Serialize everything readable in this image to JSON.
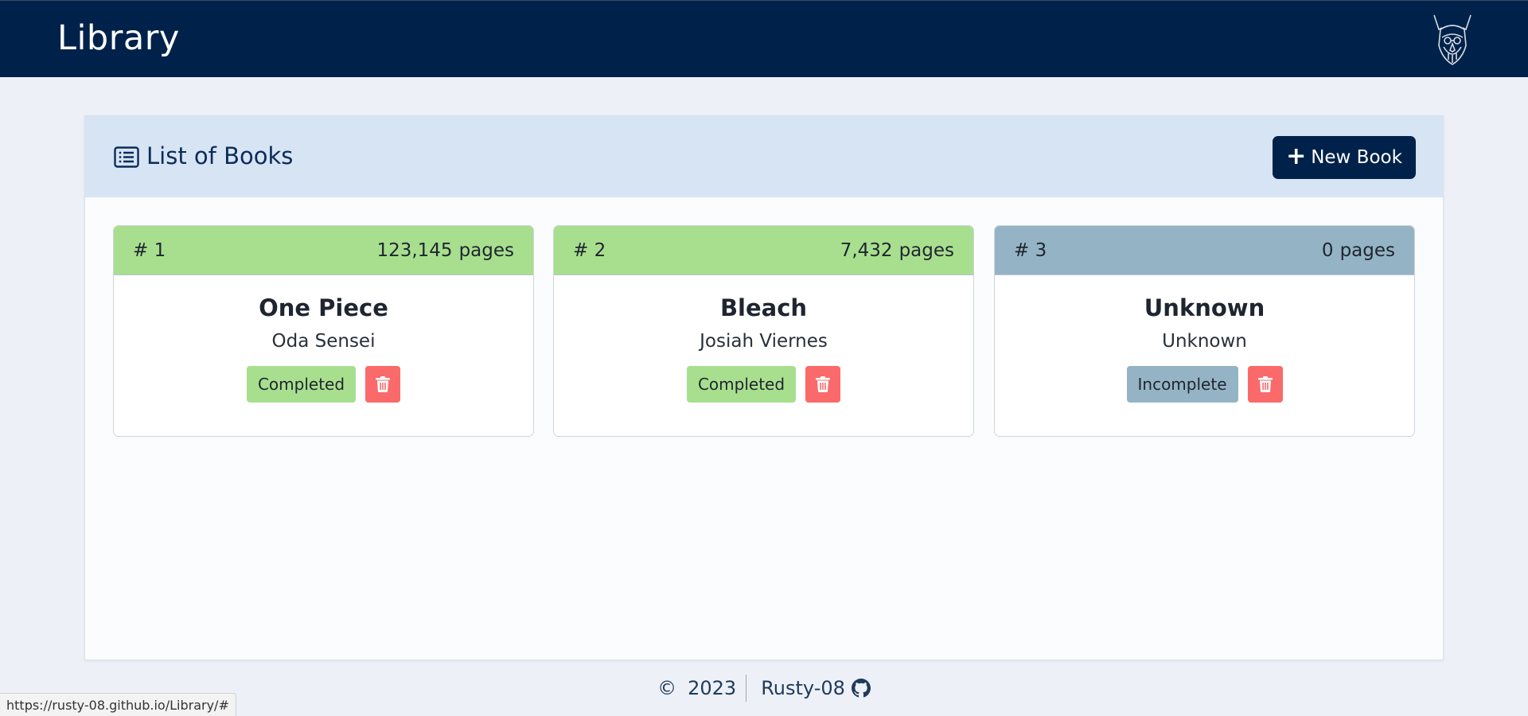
{
  "header": {
    "title": "Library",
    "logo_icon": "viking-helmet-logo-icon"
  },
  "panel": {
    "title": "List of Books",
    "title_icon": "list-icon",
    "new_book_button": "New Book",
    "new_book_icon": "plus-icon"
  },
  "books": [
    {
      "number": "# 1",
      "pages": "123,145",
      "pages_unit": "pages",
      "title": "One Piece",
      "author": "Oda Sensei",
      "status": "Completed",
      "status_color": "#a8df8e"
    },
    {
      "number": "# 2",
      "pages": "7,432",
      "pages_unit": "pages",
      "title": "Bleach",
      "author": "Josiah Viernes",
      "status": "Completed",
      "status_color": "#a8df8e"
    },
    {
      "number": "# 3",
      "pages": "0",
      "pages_unit": "pages",
      "title": "Unknown",
      "author": "Unknown",
      "status": "Incomplete",
      "status_color": "#94b4c5"
    }
  ],
  "footer": {
    "copyright_symbol": "©",
    "year": "2023",
    "author": "Rusty-08",
    "author_icon": "github-icon"
  },
  "status_bar": {
    "url": "https://rusty-08.github.io/Library/#"
  },
  "colors": {
    "navbar": "#00224a",
    "panel_header": "#d7e4f3",
    "completed": "#a8df8e",
    "incomplete": "#94b4c5",
    "delete": "#fb6a6a"
  }
}
